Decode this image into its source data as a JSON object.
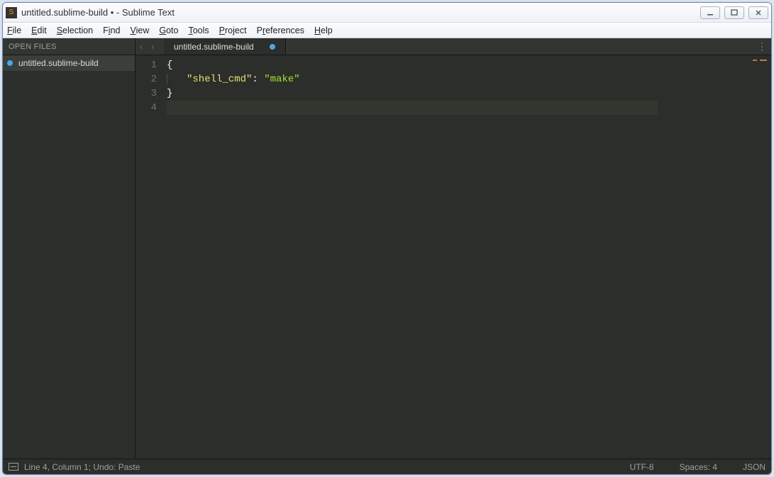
{
  "window": {
    "title": "untitled.sublime-build • - Sublime Text"
  },
  "menu": {
    "file": "File",
    "edit": "Edit",
    "selection": "Selection",
    "find": "Find",
    "view": "View",
    "goto": "Goto",
    "tools": "Tools",
    "project": "Project",
    "preferences": "Preferences",
    "help": "Help"
  },
  "sidebar": {
    "header": "OPEN FILES",
    "files": [
      {
        "name": "untitled.sublime-build",
        "modified": true
      }
    ]
  },
  "tabs": [
    {
      "name": "untitled.sublime-build",
      "modified": true,
      "active": true
    }
  ],
  "editor": {
    "line_numbers": [
      "1",
      "2",
      "3",
      "4"
    ],
    "cursor_line": 4,
    "lines": [
      {
        "tokens": [
          {
            "cls": "tok-punc",
            "text": "{"
          }
        ]
      },
      {
        "indent_guide": true,
        "tokens": [
          {
            "cls": "tok-key",
            "text": "\"shell_cmd\""
          },
          {
            "cls": "tok-punc",
            "text": ": "
          },
          {
            "cls": "tok-val",
            "text": "\"make\""
          }
        ]
      },
      {
        "tokens": [
          {
            "cls": "tok-punc",
            "text": "}"
          }
        ]
      },
      {
        "tokens": []
      }
    ]
  },
  "status": {
    "left": "Line 4, Column 1; Undo: Paste",
    "encoding": "UTF-8",
    "spaces": "Spaces: 4",
    "syntax": "JSON"
  }
}
